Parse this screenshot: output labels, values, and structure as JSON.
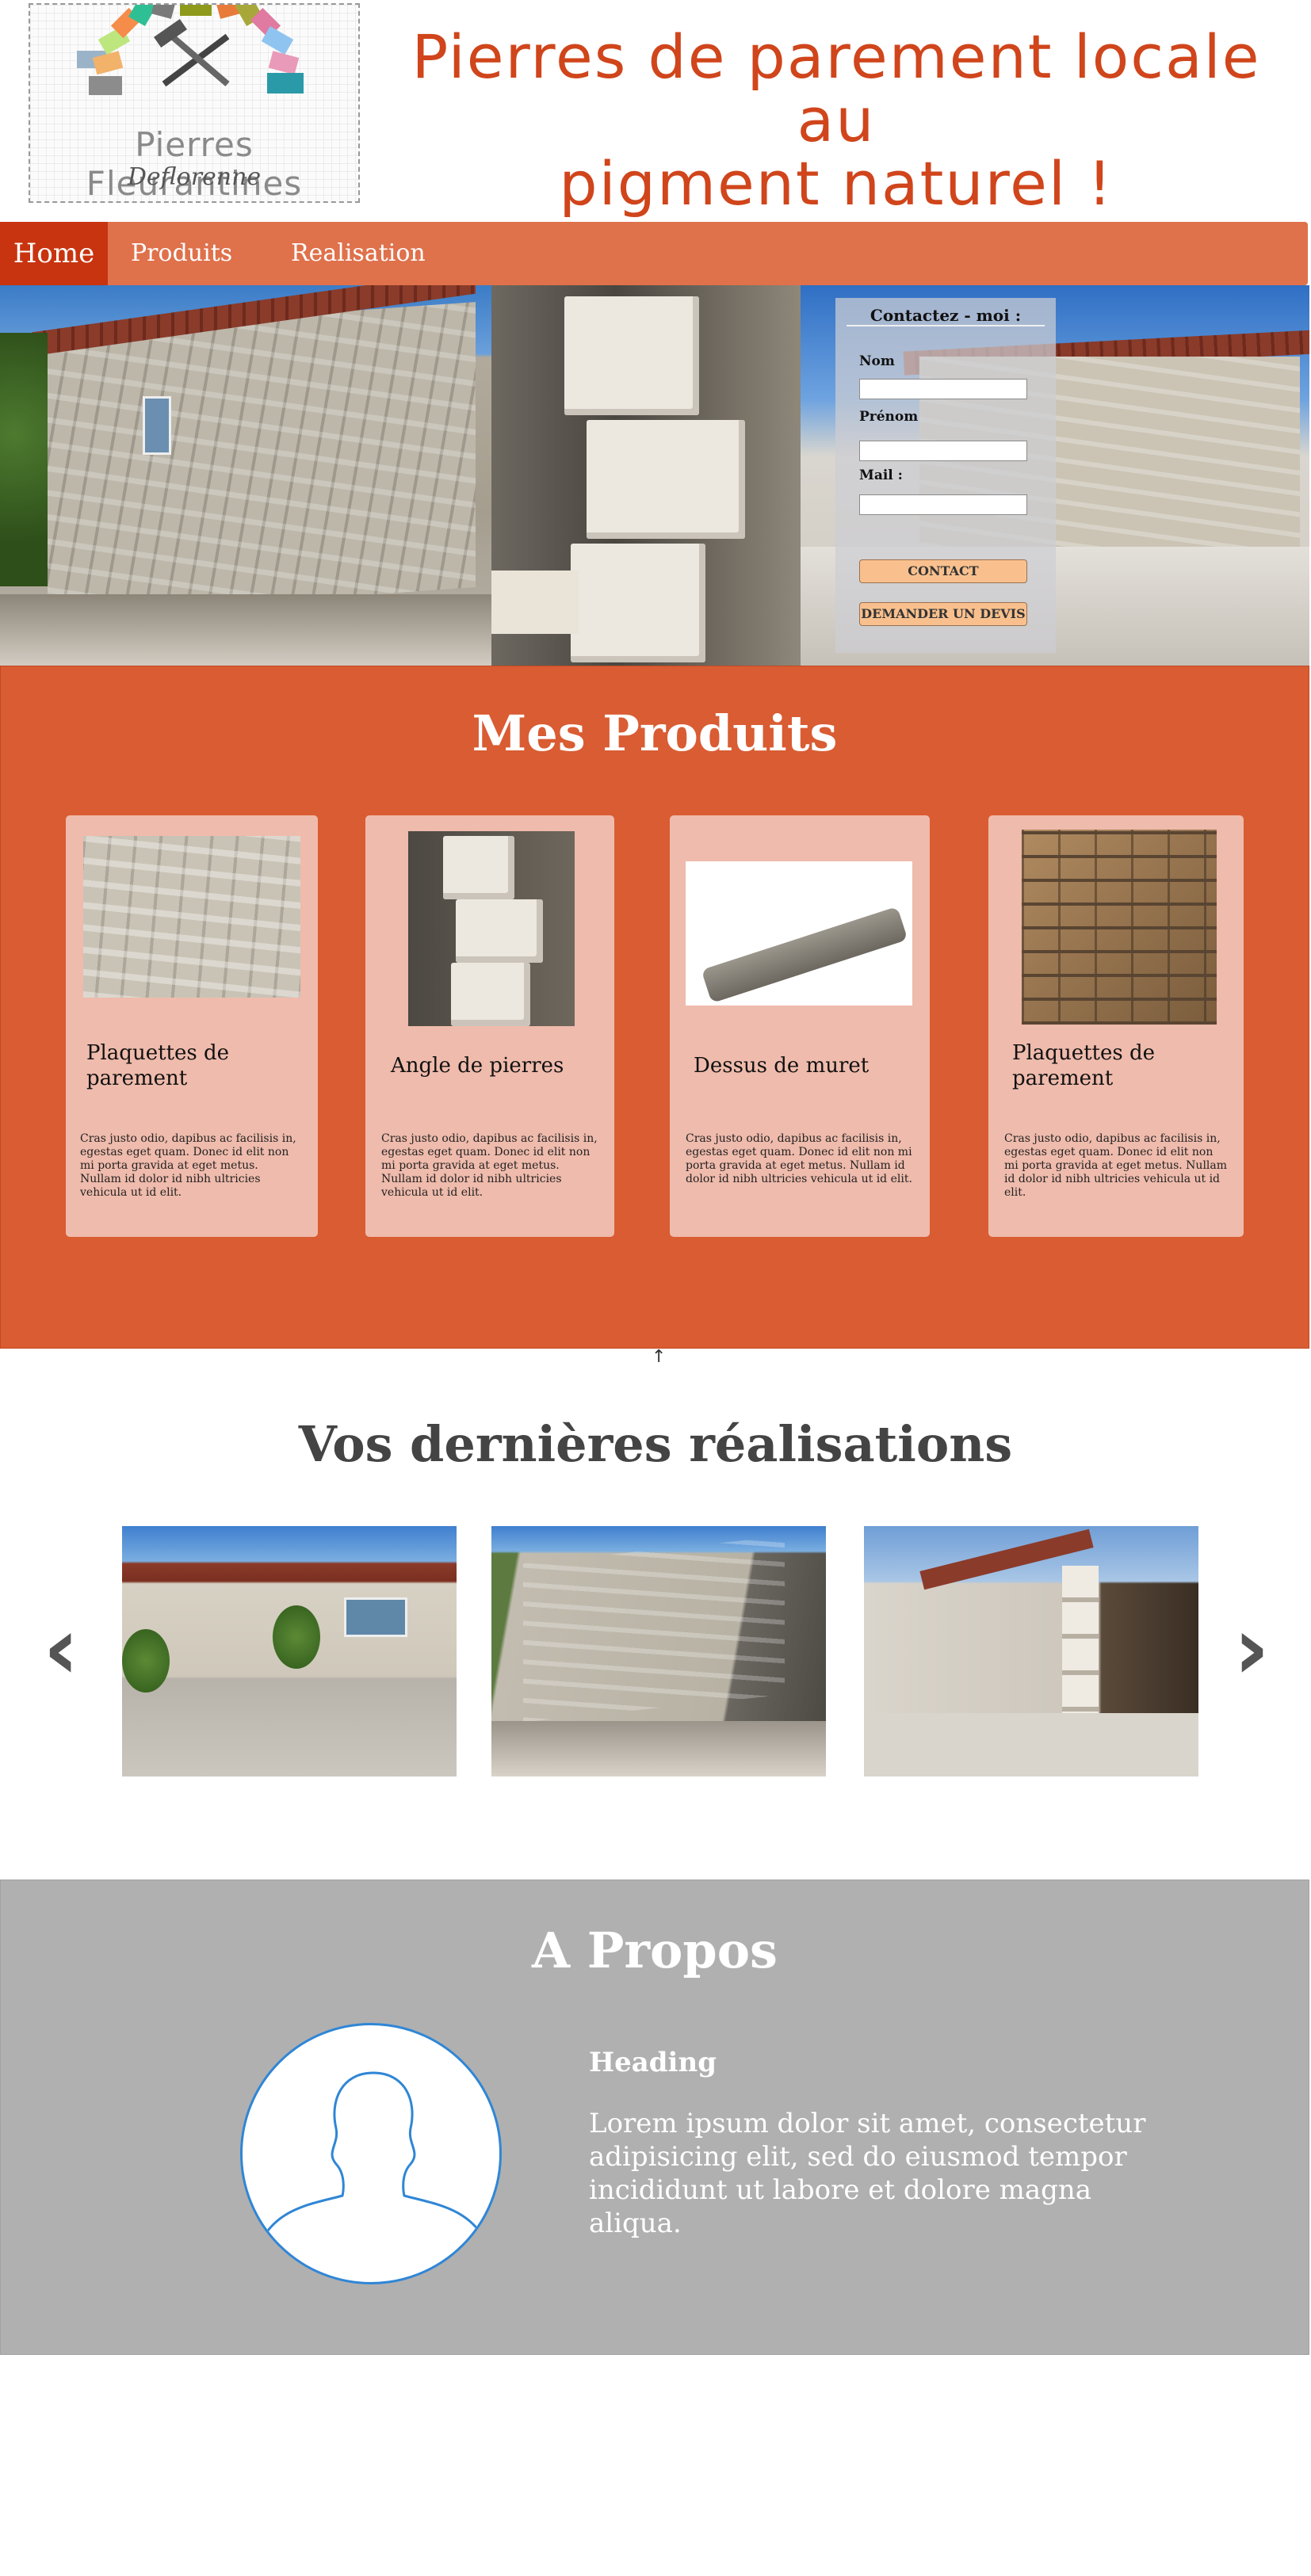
{
  "header": {
    "logo_brand": "Pierres Fleurantines",
    "logo_sub": "Deflorenne",
    "tagline_line1": "Pierres de parement locale au",
    "tagline_line2": "pigment naturel !"
  },
  "nav": {
    "items": [
      {
        "label": "Home",
        "active": true
      },
      {
        "label": "Produits"
      },
      {
        "label": "Realisation"
      }
    ]
  },
  "contact": {
    "title": "Contactez - moi :",
    "nom_label": "Nom",
    "prenom_label": "Prénom",
    "mail_label": "Mail :",
    "contact_button": "CONTACT",
    "devis_button": "DEMANDER UN DEVIS"
  },
  "produits": {
    "title": "Mes Produits",
    "cards": [
      {
        "title": "Plaquettes de parement",
        "text": "Cras justo odio, dapibus ac facilisis in, egestas eget quam. Donec id elit non mi porta gravida at eget metus. Nullam id dolor id nibh ultricies vehicula ut id elit."
      },
      {
        "title": "Angle de pierres",
        "text": "Cras justo odio, dapibus ac facilisis in, egestas eget quam. Donec id elit non mi porta gravida at eget metus. Nullam id dolor id nibh ultricies vehicula ut id elit."
      },
      {
        "title": "Dessus de muret",
        "text": "Cras justo odio, dapibus ac facilisis in, egestas eget quam. Donec id elit non mi porta gravida at eget metus. Nullam id dolor id nibh ultricies vehicula ut id elit."
      },
      {
        "title": "Plaquettes de parement",
        "text": "Cras justo odio, dapibus ac facilisis in, egestas eget quam. Donec id elit non mi porta gravida at eget metus. Nullam id dolor id nibh ultricies vehicula ut id elit."
      }
    ]
  },
  "scroll_arrow": "↑",
  "realisations": {
    "title": "Vos dernières réalisations",
    "prev_icon": "chevron-left-icon",
    "next_icon": "chevron-right-icon",
    "prev_glyph": "‹",
    "next_glyph": "›"
  },
  "about": {
    "title": "A Propos",
    "heading": "Heading",
    "text": "Lorem ipsum dolor sit amet, consectetur adipisicing elit, sed do eiusmod tempor incididunt ut labore et dolore magna aliqua."
  },
  "colors": {
    "nav_bg": "#df714b",
    "nav_active": "#c8340f",
    "produits_bg": "#d95c33",
    "card_bg": "#efbbac",
    "about_bg": "#b0b0b0",
    "tagline": "#d0451b",
    "button": "#f9c08e"
  }
}
